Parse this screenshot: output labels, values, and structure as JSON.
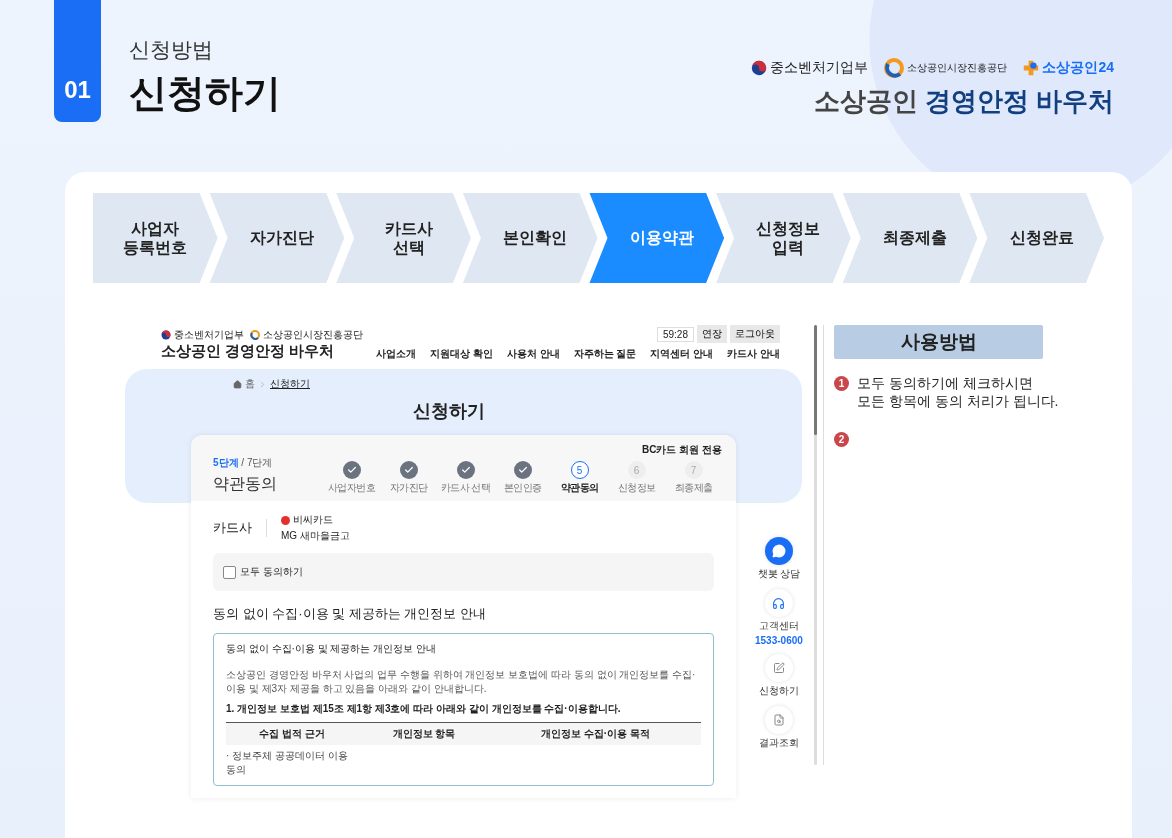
{
  "header": {
    "badge": "01",
    "subtitle": "신청방법",
    "title": "신청하기"
  },
  "logos": [
    {
      "kind": "ministry",
      "text": "중소벤처기업부"
    },
    {
      "kind": "agency",
      "text": "소상공인시장진흥공단"
    },
    {
      "kind": "portal",
      "text": "소상공인24"
    }
  ],
  "brand": {
    "lead": "소상공인",
    "main": "경영안정 바우처"
  },
  "steps": [
    {
      "label": "사업자\n등록번호",
      "selected": false
    },
    {
      "label": "자가진단",
      "selected": false
    },
    {
      "label": "카드사\n선택",
      "selected": false
    },
    {
      "label": "본인확인",
      "selected": false
    },
    {
      "label": "이용약관",
      "selected": true
    },
    {
      "label": "신청정보\n입력",
      "selected": false
    },
    {
      "label": "최종제출",
      "selected": false
    },
    {
      "label": "신청완료",
      "selected": false
    }
  ],
  "screen": {
    "site_logos": [
      {
        "kind": "ministry",
        "text": "중소벤처기업부"
      },
      {
        "kind": "agency",
        "text": "소상공인시장진흥공단"
      }
    ],
    "site_title": "소상공인 경영안정 바우처",
    "timer": "59:28",
    "extend": "연장",
    "logout": "로그아웃",
    "nav": [
      "사업소개",
      "지원대상 확인",
      "사용처 안내",
      "자주하는 질문",
      "지역센터 안내",
      "카드사 안내"
    ],
    "breadcrumb": {
      "home": "홈",
      "current": "신청하기"
    },
    "page_title": "신청하기",
    "card": {
      "step_current": "5단계",
      "step_total": "/ 7단계",
      "heading": "약관동의",
      "member": "BC카드 회원 전용",
      "progress": [
        {
          "label": "사업자번호",
          "done": true,
          "current": false
        },
        {
          "label": "자가진단",
          "done": true,
          "current": false
        },
        {
          "label": "카드사 선택",
          "done": true,
          "current": false
        },
        {
          "label": "본인인증",
          "done": true,
          "current": false
        },
        {
          "label": "약관동의",
          "done": false,
          "current": true,
          "number": "5"
        },
        {
          "label": "신청정보",
          "done": false,
          "current": false,
          "number": "6"
        },
        {
          "label": "최종제출",
          "done": false,
          "current": false,
          "number": "7"
        }
      ],
      "company_label": "카드사",
      "companies": [
        {
          "name": "비씨카드",
          "logo": true
        },
        {
          "name": "MG 새마을금고",
          "logo": false
        }
      ],
      "agree_all": {
        "label": "모두 동의하기",
        "checked": false
      },
      "section_title": "동의 없이 수집·이용 및 제공하는 개인정보 안내",
      "terms": {
        "title": "동의 없이 수집·이용 및 제공하는 개인정보 안내",
        "paragraph": "소상공인 경영안정 바우처 사업의 업무 수행을 위하여 개인정보 보호법에 따라 동의 없이 개인정보를 수집·이용 및 제3자 제공을 하고 있음을 아래와 같이 안내합니다.",
        "clause": "1. 개인정보 보호법 제15조 제1항 제3호에 따라 아래와 같이 개인정보를 수집·이용합니다.",
        "columns": [
          "수집 법적 근거",
          "개인정보 항목",
          "개인정보 수집·이용 목적"
        ],
        "rows": [
          [
            "· 정보주체 공공데이터 이용 동의"
          ]
        ]
      }
    },
    "quick_menu": [
      {
        "kind": "chat",
        "label": "챗봇 상담"
      },
      {
        "kind": "headset",
        "label": "고객센터",
        "phone": "1533-0600"
      },
      {
        "kind": "edit",
        "label": "신청하기"
      },
      {
        "kind": "search",
        "label": "결과조회"
      }
    ]
  },
  "guide": {
    "title": "사용방법",
    "items": [
      {
        "number": "1",
        "text": "모두 동의하기에 체크하시면\n모든 항목에 동의 처리가 됩니다."
      },
      {
        "number": "2"
      }
    ]
  }
}
